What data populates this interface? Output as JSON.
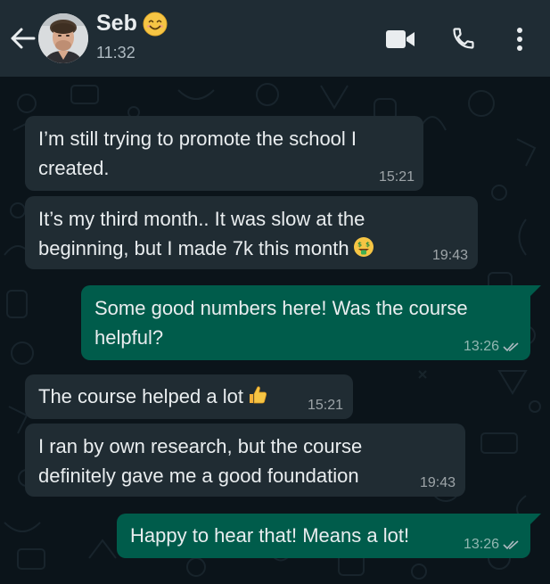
{
  "header": {
    "contact_name": "Seb",
    "status": "11:32",
    "name_emoji": "smiling-face-emoji",
    "icons": [
      "back-arrow-icon",
      "video-call-icon",
      "voice-call-icon",
      "more-options-icon"
    ]
  },
  "messages": [
    {
      "direction": "incoming",
      "lines": [
        "I’m still trying to promote the school I",
        "created."
      ],
      "time": "15:21"
    },
    {
      "direction": "incoming",
      "lines": [
        "It’s my third month.. It was slow at the",
        "beginning, but I made 7k this month"
      ],
      "emoji": "money-mouth-face-emoji",
      "time": "19:43"
    },
    {
      "direction": "outgoing",
      "lines": [
        "Some good numbers here! Was the course",
        "helpful?"
      ],
      "time": "13:26",
      "status_icon": "double-check-icon"
    },
    {
      "direction": "incoming",
      "lines": [
        "The course helped a lot"
      ],
      "emoji": "thumbs-up-emoji",
      "time": "15:21"
    },
    {
      "direction": "incoming",
      "lines": [
        "I ran by own research, but the course",
        "definitely gave me a good foundation"
      ],
      "time": "19:43"
    },
    {
      "direction": "outgoing",
      "lines": [
        "Happy to hear that! Means a lot!"
      ],
      "time": "13:26",
      "status_icon": "double-check-icon"
    }
  ],
  "colors": {
    "header_bg": "#1f2c34",
    "chat_bg": "#0b141a",
    "incoming_bubble": "#202c33",
    "outgoing_bubble": "#005c4b",
    "text": "#e9edef"
  }
}
